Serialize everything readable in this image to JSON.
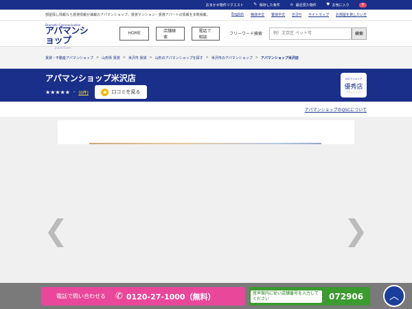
{
  "topbar": {
    "items": [
      {
        "label": "おまかせ物件リクエスト",
        "icon": "none"
      },
      {
        "label": "保存した条件",
        "icon": "pencil-icon"
      },
      {
        "label": "最近見た物件",
        "icon": "house-icon"
      },
      {
        "label": "お気に入り",
        "icon": "heart-icon"
      }
    ],
    "favorites_count": "0"
  },
  "subrow": {
    "description": "部屋探し情報なら賃貸情報が満載のアパマンショップ。賃貸マンション・賃貸アパートの情報を多数掲載。",
    "languages": [
      "English",
      "簡体中文",
      "繁体中文",
      "한국어",
      "サイトマップ",
      "お部屋を貸したい方"
    ]
  },
  "header": {
    "logo_small": "Dramatic Communication",
    "logo_main": "アパマンショップ",
    "logo_sub": "a p a m a n",
    "nav": [
      "HOME",
      "店舗検索",
      "電話で相談"
    ],
    "freeword_label": "フリーワード検索",
    "search_placeholder": "例）文京区 ペット可",
    "search_button": "検索"
  },
  "breadcrumb": [
    "賃貸・不動産アパマンショップ",
    "山形県 賃貸",
    "米沢市 賃貸",
    "山形のアパマンショップを探す",
    "米沢市のアパマンショップ",
    "アパマンショップ米沢店"
  ],
  "store": {
    "name": "アパマンショップ米沢店",
    "stars": "★★★★★",
    "separator": "-",
    "review_count": "(0件)",
    "review_button": "口コミを見る",
    "qsc_top": "QSCランキング",
    "qsc_main": "優秀店",
    "qsc_bottom": "アパマンショップ"
  },
  "qsc_link": "アパマンショップのQSCについて",
  "gallery": {
    "left_arrow": "❮",
    "right_arrow": "❯"
  },
  "bottom": {
    "call_label": "電話で問い合わせる",
    "phone_number": "0120-27-1000（無料）",
    "voice_text": "音声案内に従い店舗番号を入力してください",
    "store_code": "072906",
    "pagetop_icon": "chevron-up-icon"
  },
  "colors": {
    "brand_blue": "#1a2f8a",
    "call_pink": "#e8479a",
    "voice_green": "#3b9b2f"
  }
}
